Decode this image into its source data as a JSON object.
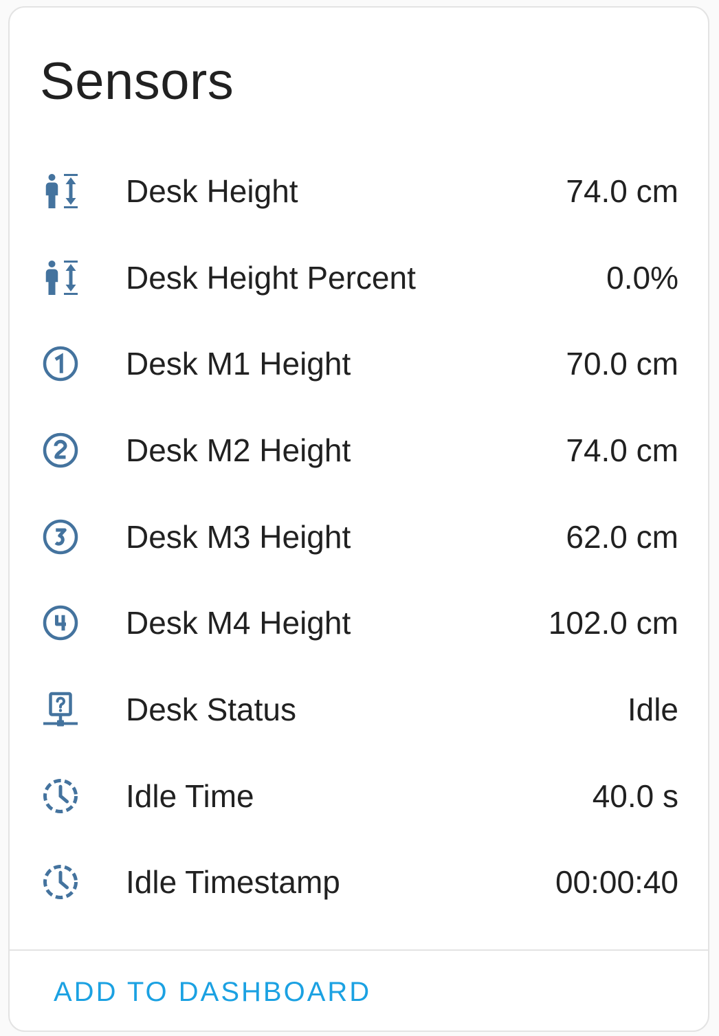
{
  "card": {
    "title": "Sensors",
    "action_label": "ADD TO DASHBOARD"
  },
  "colors": {
    "icon": "#44739e",
    "text": "#212121",
    "accent": "#1ba1e2"
  },
  "sensors": [
    {
      "icon": "human-male-height-icon",
      "name": "Desk Height",
      "value": "74.0 cm"
    },
    {
      "icon": "human-male-height-icon",
      "name": "Desk Height Percent",
      "value": "0.0%"
    },
    {
      "icon": "numeric-1-circle-icon",
      "name": "Desk M1 Height",
      "value": "70.0 cm"
    },
    {
      "icon": "numeric-2-circle-icon",
      "name": "Desk M2 Height",
      "value": "74.0 cm"
    },
    {
      "icon": "numeric-3-circle-icon",
      "name": "Desk M3 Height",
      "value": "62.0 cm"
    },
    {
      "icon": "numeric-4-circle-icon",
      "name": "Desk M4 Height",
      "value": "102.0 cm"
    },
    {
      "icon": "help-network-icon",
      "name": "Desk Status",
      "value": "Idle"
    },
    {
      "icon": "clock-dashed-icon",
      "name": "Idle Time",
      "value": "40.0 s"
    },
    {
      "icon": "clock-dashed-icon",
      "name": "Idle Timestamp",
      "value": "00:00:40"
    }
  ]
}
